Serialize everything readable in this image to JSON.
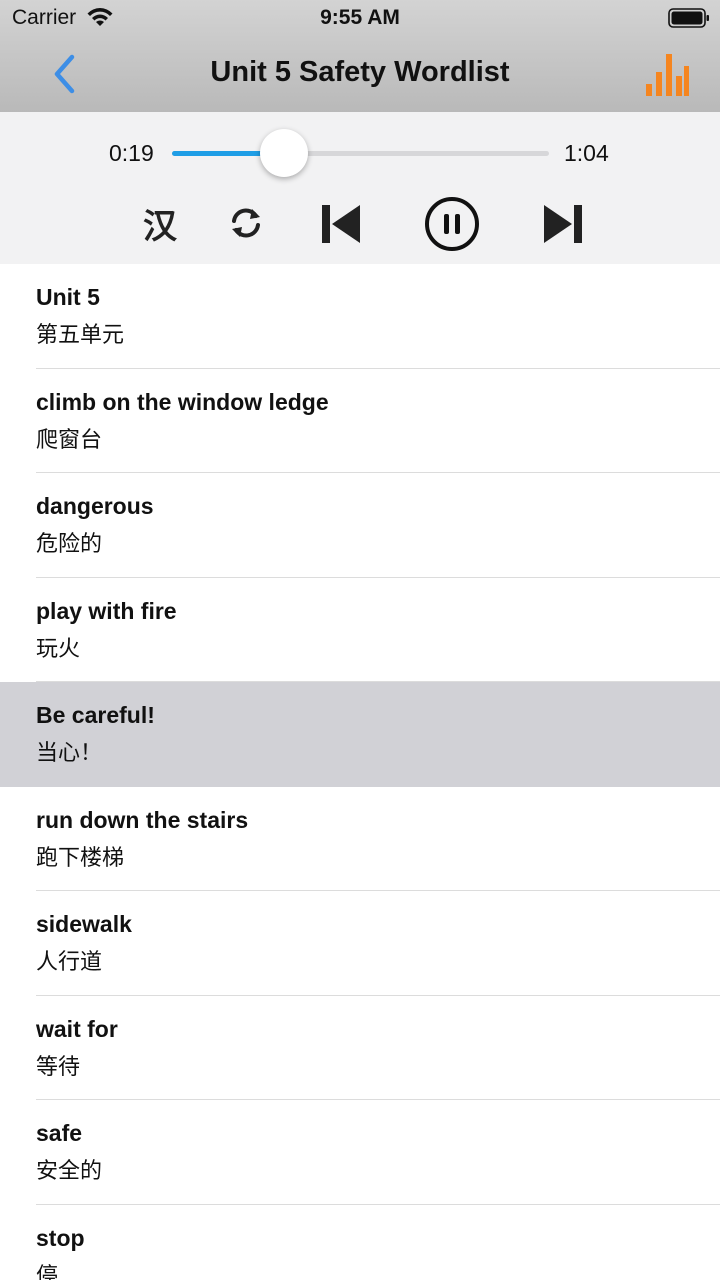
{
  "status_bar": {
    "carrier": "Carrier",
    "time": "9:55 AM"
  },
  "nav": {
    "title": "Unit 5 Safety Wordlist",
    "back_icon": "chevron-left-icon",
    "stats_icon": "bar-chart-icon"
  },
  "player": {
    "current_time": "0:19",
    "total_time": "1:04",
    "progress_fraction": 0.297,
    "han_toggle_label": "汉",
    "controls": [
      "chinese-toggle",
      "repeat",
      "previous",
      "pause",
      "next"
    ]
  },
  "colors": {
    "accent_blue": "#1f9ee6",
    "back_blue": "#3d8ee6",
    "stats_orange": "#f5851f",
    "selected_row": "#d1d1d6"
  },
  "words": [
    {
      "en": "Unit 5",
      "zh": "第五单元"
    },
    {
      "en": "climb on the window ledge",
      "zh": "爬窗台"
    },
    {
      "en": "dangerous",
      "zh": "危险的"
    },
    {
      "en": "play with fire",
      "zh": "玩火"
    },
    {
      "en": "Be careful!",
      "zh": "当心！",
      "selected": true
    },
    {
      "en": "run down the stairs",
      "zh": "跑下楼梯"
    },
    {
      "en": "sidewalk",
      "zh": "人行道"
    },
    {
      "en": "wait for",
      "zh": "等待"
    },
    {
      "en": "safe",
      "zh": "安全的"
    },
    {
      "en": "stop",
      "zh": "停"
    }
  ]
}
